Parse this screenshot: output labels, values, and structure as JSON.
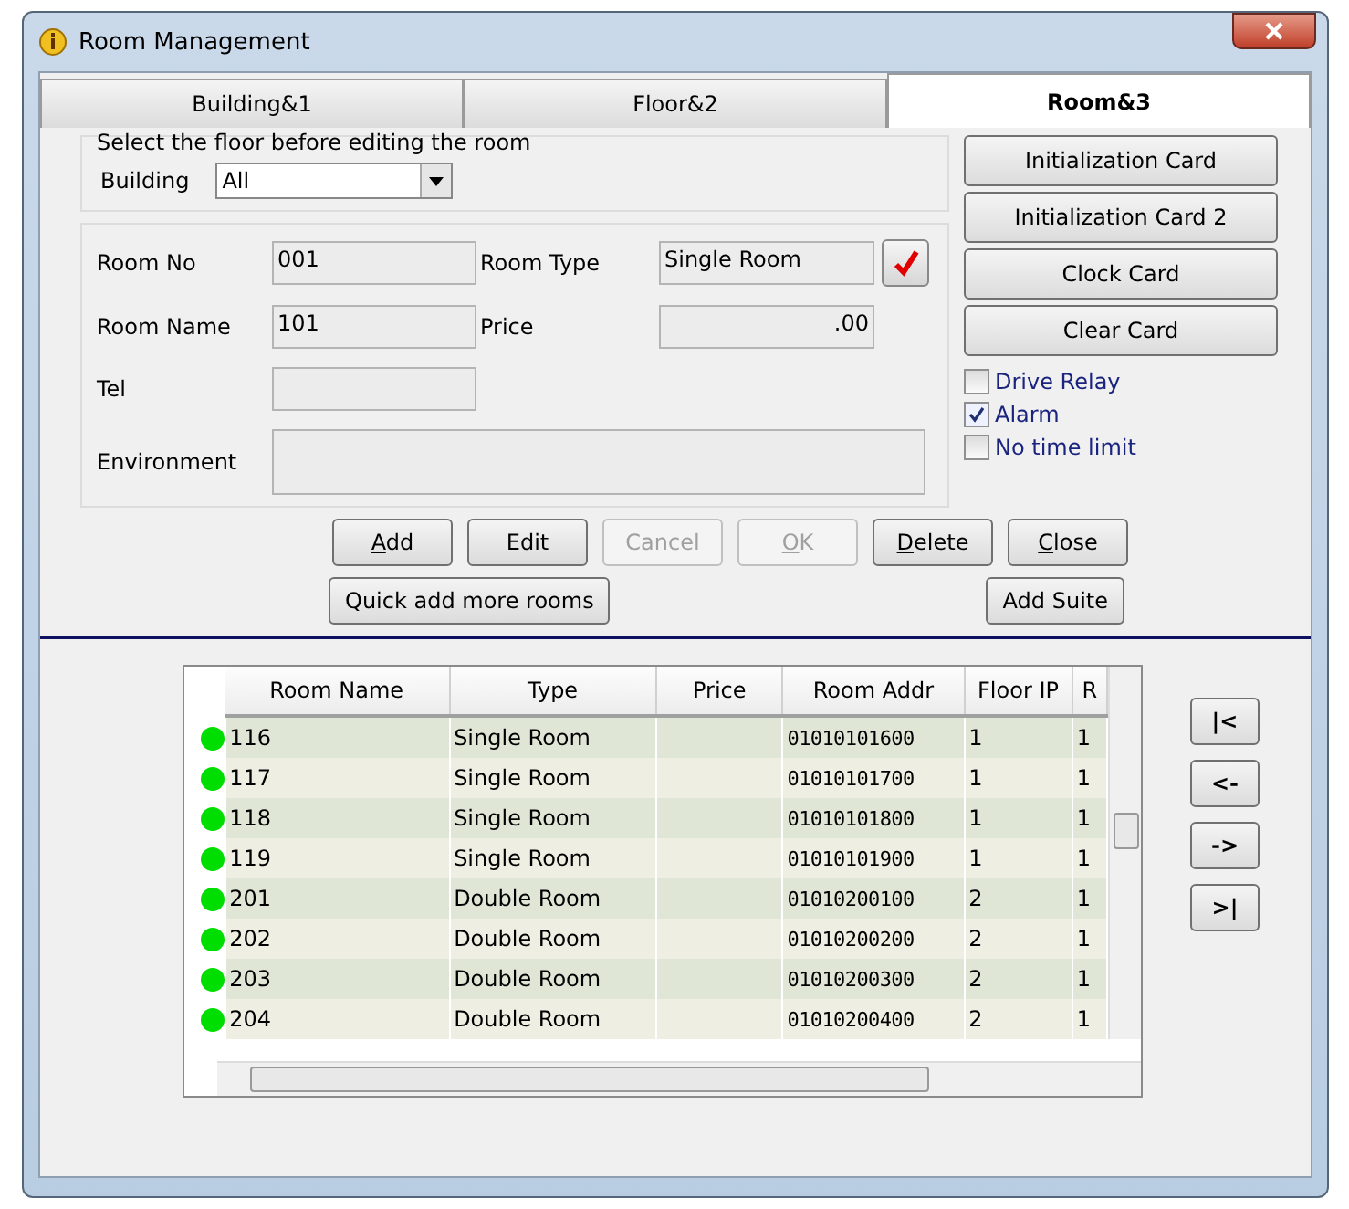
{
  "window": {
    "title": "Room Management"
  },
  "tabs": [
    {
      "label": "Building&1",
      "selected": false
    },
    {
      "label": "Floor&2",
      "selected": false
    },
    {
      "label": "Room&3",
      "selected": true
    }
  ],
  "floor_select": {
    "legend": "Select the floor before editing the room",
    "label": "Building",
    "value": "All"
  },
  "fields": [
    {
      "label": "Room No",
      "value": "001"
    },
    {
      "label": "Room Type",
      "value": "Single Room"
    },
    {
      "label": "Room Name",
      "value": "101"
    },
    {
      "label": "Price",
      "value": ".00"
    },
    {
      "label": "Tel"
    },
    {
      "label": "Environment"
    }
  ],
  "card_buttons": [
    "Initialization Card",
    "Initialization Card 2",
    "Clock Card",
    "Clear Card"
  ],
  "options": [
    {
      "label": "Drive Relay",
      "checked": false
    },
    {
      "label": "Alarm",
      "checked": true
    },
    {
      "label": "No time limit",
      "checked": false
    }
  ],
  "actions": [
    {
      "label": "Add",
      "disabled": false,
      "underline_first": true
    },
    {
      "label": "Edit",
      "disabled": false,
      "underline_first": false
    },
    {
      "label": "Cancel",
      "disabled": true,
      "underline_first": false
    },
    {
      "label": "OK",
      "disabled": true,
      "underline_first": true
    },
    {
      "label": "Delete",
      "disabled": false,
      "underline_first": true
    },
    {
      "label": "Close",
      "disabled": false,
      "underline_first": true
    }
  ],
  "quick_add": "Quick add more rooms",
  "add_suite": "Add Suite",
  "table": {
    "columns": [
      "Room Name",
      "Type",
      "Price",
      "Room Addr",
      "Floor IP",
      "R"
    ],
    "rows": [
      {
        "color": "#00dd00",
        "cells": [
          "116",
          "Single Room",
          "",
          "01010101600",
          "1",
          "1"
        ]
      },
      {
        "color": "#00dd00",
        "cells": [
          "117",
          "Single Room",
          "",
          "01010101700",
          "1",
          "1"
        ]
      },
      {
        "color": "#00dd00",
        "cells": [
          "118",
          "Single Room",
          "",
          "01010101800",
          "1",
          "1"
        ]
      },
      {
        "color": "#00dd00",
        "cells": [
          "119",
          "Single Room",
          "",
          "01010101900",
          "1",
          "1"
        ]
      },
      {
        "color": "#00dd00",
        "cells": [
          "201",
          "Double Room",
          "",
          "01010200100",
          "2",
          "1"
        ]
      },
      {
        "color": "#00dd00",
        "cells": [
          "202",
          "Double Room",
          "",
          "01010200200",
          "2",
          "1"
        ]
      },
      {
        "color": "#00dd00",
        "cells": [
          "203",
          "Double Room",
          "",
          "01010200300",
          "2",
          "1"
        ]
      },
      {
        "color": "#00dd00",
        "cells": [
          "204",
          "Double Room",
          "",
          "01010200400",
          "2",
          "1"
        ]
      }
    ]
  },
  "nav_buttons": [
    "|<",
    "<-",
    "->",
    ">|"
  ]
}
